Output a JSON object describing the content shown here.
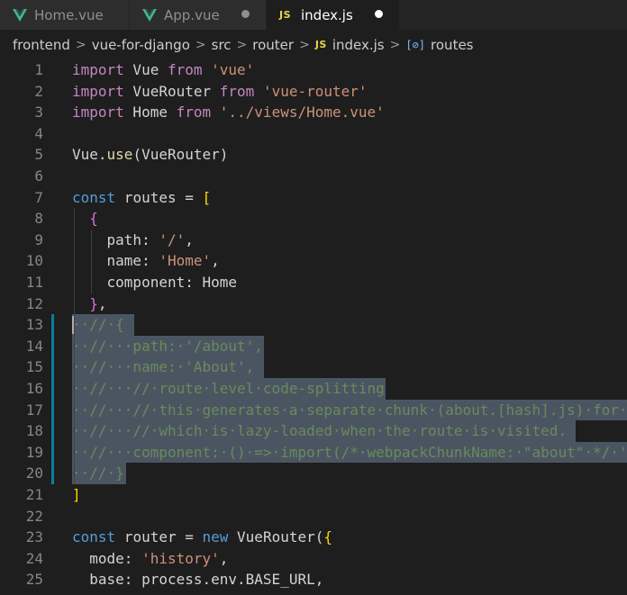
{
  "tabs": [
    {
      "label": "Home.vue",
      "icon": "vue-icon",
      "active": false,
      "modified": false
    },
    {
      "label": "App.vue",
      "icon": "vue-icon",
      "active": false,
      "modified": true
    },
    {
      "label": "index.js",
      "icon": "js-icon",
      "active": true,
      "modified": true
    }
  ],
  "breadcrumb": {
    "items": [
      "frontend",
      "vue-for-django",
      "src",
      "router",
      "index.js",
      "routes"
    ],
    "js_icon_text": "JS"
  },
  "editor": {
    "line_numbers": [
      "1",
      "2",
      "3",
      "4",
      "5",
      "6",
      "7",
      "8",
      "9",
      "10",
      "11",
      "12",
      "13",
      "14",
      "15",
      "16",
      "17",
      "18",
      "19",
      "20",
      "21",
      "22",
      "23",
      "24",
      "25"
    ],
    "lines": [
      [
        [
          "kwc",
          "import"
        ],
        [
          "def",
          " Vue "
        ],
        [
          "kwc",
          "from"
        ],
        [
          "def",
          " "
        ],
        [
          "str",
          "'vue'"
        ]
      ],
      [
        [
          "kwc",
          "import"
        ],
        [
          "def",
          " VueRouter "
        ],
        [
          "kwc",
          "from"
        ],
        [
          "def",
          " "
        ],
        [
          "str",
          "'vue-router'"
        ]
      ],
      [
        [
          "kwc",
          "import"
        ],
        [
          "def",
          " Home "
        ],
        [
          "kwc",
          "from"
        ],
        [
          "def",
          " "
        ],
        [
          "str",
          "'../views/Home.vue'"
        ]
      ],
      [],
      [
        [
          "def",
          "Vue."
        ],
        [
          "fn",
          "use"
        ],
        [
          "def",
          "(VueRouter)"
        ]
      ],
      [],
      [
        [
          "kw",
          "const"
        ],
        [
          "def",
          " routes = "
        ],
        [
          "br",
          "["
        ]
      ],
      [
        [
          "def",
          "  "
        ],
        [
          "br2",
          "{"
        ]
      ],
      [
        [
          "def",
          "    path: "
        ],
        [
          "str",
          "'/'"
        ],
        [
          "def",
          ","
        ]
      ],
      [
        [
          "def",
          "    name: "
        ],
        [
          "str",
          "'Home'"
        ],
        [
          "def",
          ","
        ]
      ],
      [
        [
          "def",
          "    component: Home"
        ]
      ],
      [
        [
          "def",
          "  "
        ],
        [
          "br2",
          "}"
        ],
        [
          "def",
          ","
        ]
      ],
      [
        [
          "cmt",
          "··//·{"
        ]
      ],
      [
        [
          "cmt",
          "··//···path:·'/about',"
        ]
      ],
      [
        [
          "cmt",
          "··//···name:·'About',"
        ]
      ],
      [
        [
          "cmt",
          "··//···//·route·level·code-splitting"
        ]
      ],
      [
        [
          "cmt",
          "··//···//·this·generates·a·separate·chunk·(about.[hash].js)·for·"
        ]
      ],
      [
        [
          "cmt",
          "··//···//·which·is·lazy-loaded·when·the·route·is·visited."
        ]
      ],
      [
        [
          "cmt",
          "··//···component:·()·=>·import(/*·webpackChunkName:·\"about\"·*/·'"
        ]
      ],
      [
        [
          "cmt",
          "··//·}"
        ]
      ],
      [
        [
          "br",
          "]"
        ]
      ],
      [],
      [
        [
          "kw",
          "const"
        ],
        [
          "def",
          " router = "
        ],
        [
          "kw",
          "new"
        ],
        [
          "def",
          " VueRouter("
        ],
        [
          "br",
          "{"
        ]
      ],
      [
        [
          "def",
          "  mode: "
        ],
        [
          "str",
          "'history'"
        ],
        [
          "def",
          ","
        ]
      ],
      [
        [
          "def",
          "  base: process.env.BASE_URL,"
        ]
      ]
    ]
  },
  "colors": {
    "background": "#1e1e1e",
    "selection": "#4b5562",
    "keyword": "#569cd6",
    "control_keyword": "#c586c0",
    "string": "#ce9178",
    "function": "#dcdcaa"
  }
}
